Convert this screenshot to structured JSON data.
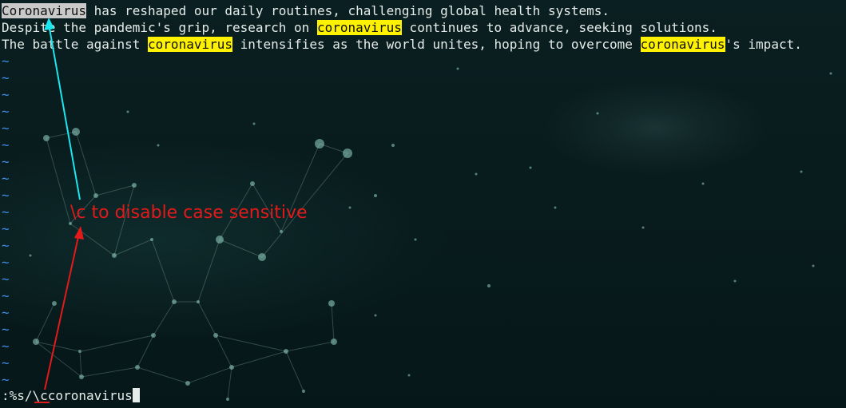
{
  "editor": {
    "lines": [
      {
        "segments": [
          {
            "text": "Coronavirus",
            "highlight": "current"
          },
          {
            "text": " has reshaped our daily routines, challenging global health systems.",
            "highlight": "none"
          }
        ]
      },
      {
        "segments": [
          {
            "text": "Despite the pandemic's grip, research on ",
            "highlight": "none"
          },
          {
            "text": "coronavirus",
            "highlight": "match"
          },
          {
            "text": " continues to advance, seeking solutions.",
            "highlight": "none"
          }
        ]
      },
      {
        "segments": [
          {
            "text": "The battle against ",
            "highlight": "none"
          },
          {
            "text": "coronavirus",
            "highlight": "match"
          },
          {
            "text": " intensifies as the world unites, hoping to overcome ",
            "highlight": "none"
          },
          {
            "text": "coronavirus",
            "highlight": "match"
          },
          {
            "text": "'s impact.",
            "highlight": "none"
          }
        ]
      }
    ],
    "empty_line_marker": "~",
    "command_line": ":%s/\\ccoronavirus"
  },
  "annotation": {
    "text": "\\c to disable case sensitive"
  },
  "colors": {
    "background": "#071a1c",
    "text": "#e6ece9",
    "tilde": "#3e8ee8",
    "search_match": "#fff200",
    "current_match": "#c9c9c9",
    "annotation_red": "#e21a1a",
    "arrow_cyan": "#19e6ee"
  }
}
